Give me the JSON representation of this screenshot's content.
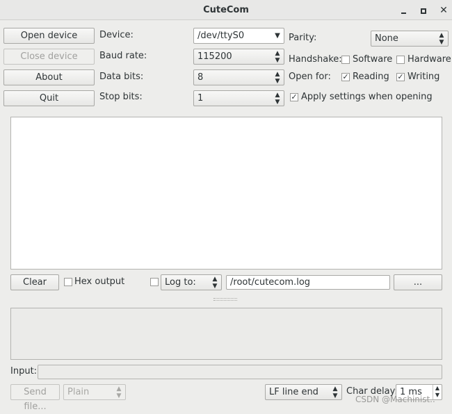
{
  "window": {
    "title": "CuteCom"
  },
  "buttons": {
    "open_device": "Open device",
    "close_device": "Close device",
    "about": "About",
    "quit": "Quit",
    "clear": "Clear",
    "browse": "...",
    "send_file": "Send file..."
  },
  "settings": {
    "device_label": "Device:",
    "device_value": "/dev/ttyS0",
    "baud_label": "Baud rate:",
    "baud_value": "115200",
    "databits_label": "Data bits:",
    "databits_value": "8",
    "stopbits_label": "Stop bits:",
    "stopbits_value": "1",
    "parity_label": "Parity:",
    "parity_value": "None",
    "handshake_label": "Handshake:",
    "software_label": "Software",
    "hardware_label": "Hardware",
    "openfor_label": "Open for:",
    "reading_label": "Reading",
    "writing_label": "Writing",
    "apply_label": "Apply settings when opening"
  },
  "output_bar": {
    "hex_label": "Hex output",
    "logto_value": "Log to:",
    "logfile_value": "/root/cutecom.log"
  },
  "input_bar": {
    "input_label": "Input:",
    "send_mode_value": "Plain",
    "line_end_value": "LF line end",
    "char_delay_label": "Char delay:",
    "char_delay_value": "1 ms"
  },
  "checkbox_state": {
    "software": false,
    "hardware": false,
    "reading": true,
    "writing": true,
    "apply": true,
    "hex": false,
    "logto": false
  },
  "watermark": "CSDN @Machinist.."
}
